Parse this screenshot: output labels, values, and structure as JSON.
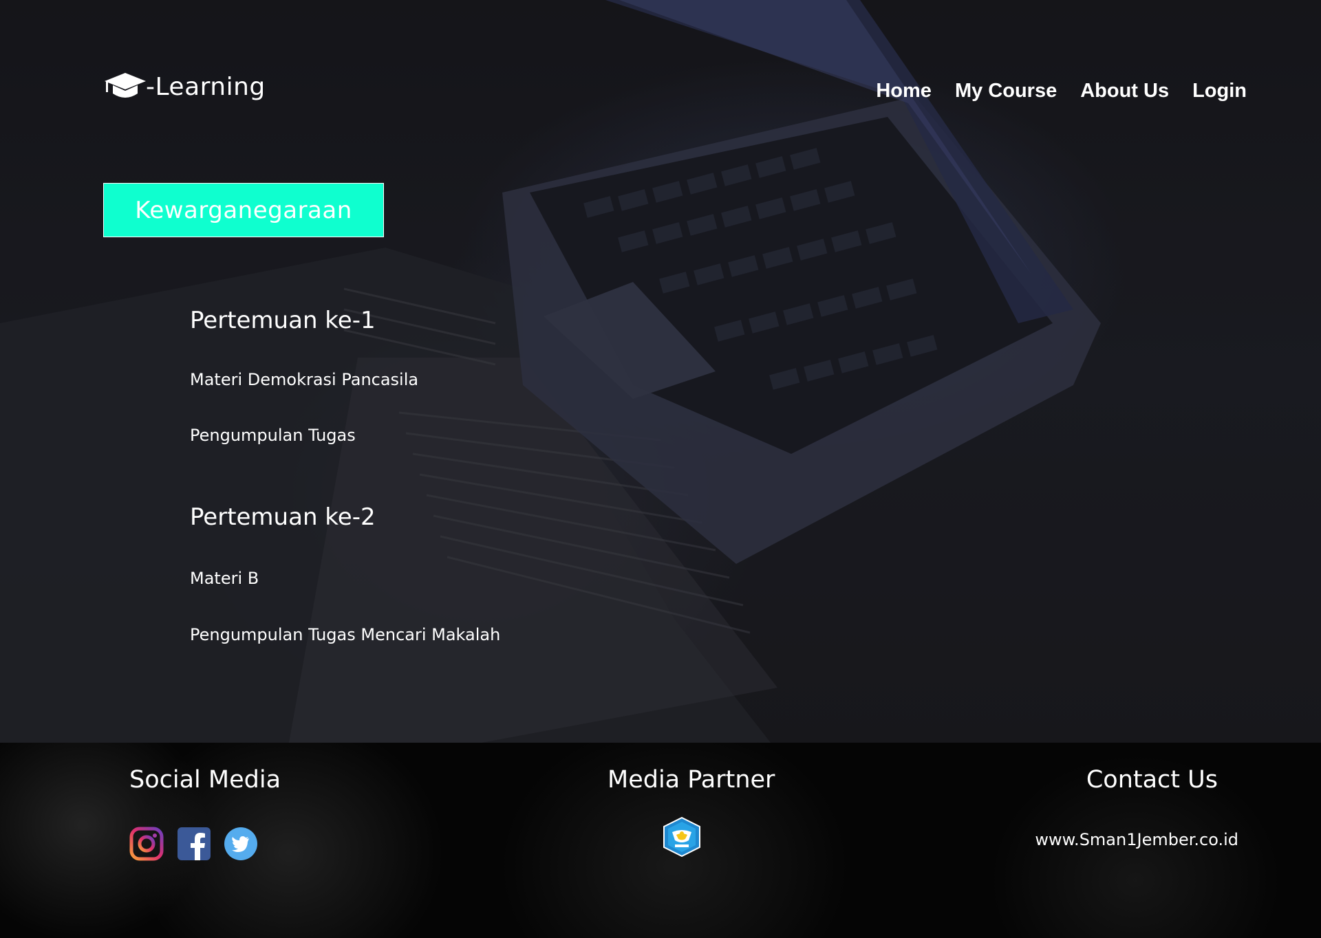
{
  "brand": {
    "logo_icon": "graduation-cap-icon",
    "suffix": "-Learning"
  },
  "nav": {
    "items": [
      "Home",
      "My Course",
      "About Us",
      "Login"
    ]
  },
  "course": {
    "name": "Kewarganegaraan",
    "accent_color": "#0fffcf"
  },
  "meetings": [
    {
      "title": "Pertemuan ke-1",
      "items": [
        "Materi Demokrasi Pancasila",
        "Pengumpulan Tugas"
      ]
    },
    {
      "title": "Pertemuan ke-2",
      "items": [
        "Materi B",
        "Pengumpulan Tugas Mencari Makalah"
      ]
    }
  ],
  "footer": {
    "social": {
      "heading": "Social Media",
      "icons": [
        "instagram-icon",
        "facebook-icon",
        "twitter-icon"
      ]
    },
    "partner": {
      "heading": "Media Partner",
      "logo": "tut-wuri-handayani-logo"
    },
    "contact": {
      "heading": "Contact Us",
      "url": "www.Sman1Jember.co.id"
    }
  }
}
